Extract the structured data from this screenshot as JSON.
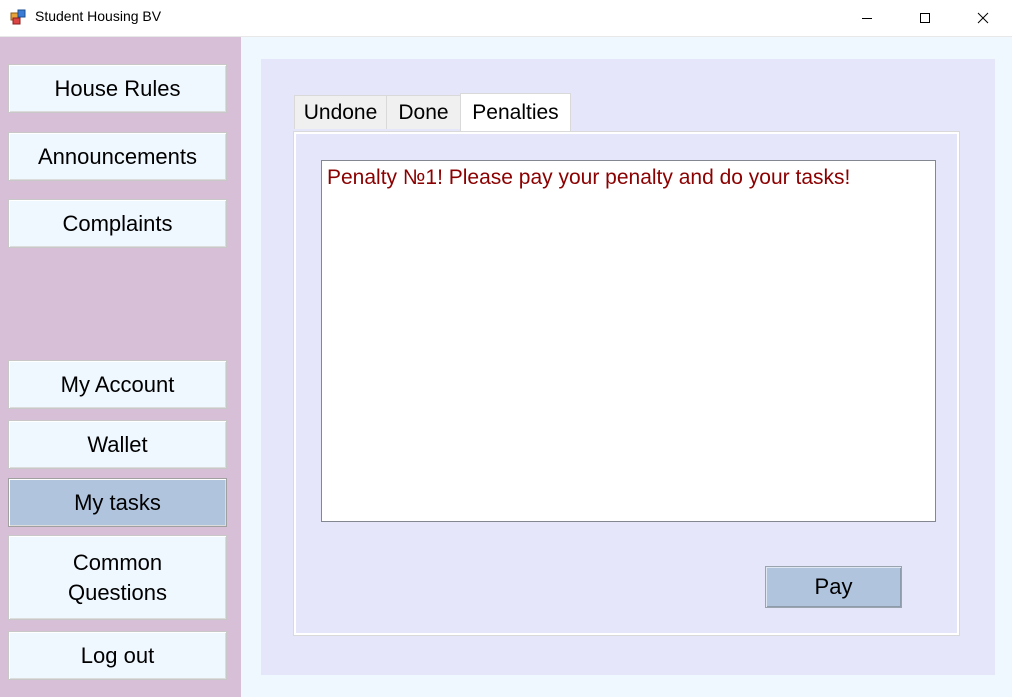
{
  "window": {
    "title": "Student Housing BV",
    "controls": {
      "minimize": "minimize-icon",
      "maximize": "maximize-icon",
      "close": "close-icon"
    }
  },
  "sidebar": {
    "top_items": [
      {
        "label": "House Rules"
      },
      {
        "label": "Announcements"
      },
      {
        "label": "Complaints"
      }
    ],
    "bottom_items": [
      {
        "label": "My Account"
      },
      {
        "label": "Wallet"
      },
      {
        "label": "My tasks",
        "active": true
      },
      {
        "label": "Common Questions"
      },
      {
        "label": "Log out"
      }
    ]
  },
  "tabs": [
    {
      "label": "Undone"
    },
    {
      "label": "Done"
    },
    {
      "label": "Penalties",
      "active": true
    }
  ],
  "penalties": {
    "items": [
      "Penalty №1! Please pay your penalty and do your tasks!"
    ],
    "pay_label": "Pay"
  },
  "colors": {
    "sidebar_bg": "#d8bfd8",
    "button_bg": "#f0f8ff",
    "active_button_bg": "#b0c4de",
    "panel_bg": "#e6e6fa",
    "penalty_text": "#8b0000"
  }
}
